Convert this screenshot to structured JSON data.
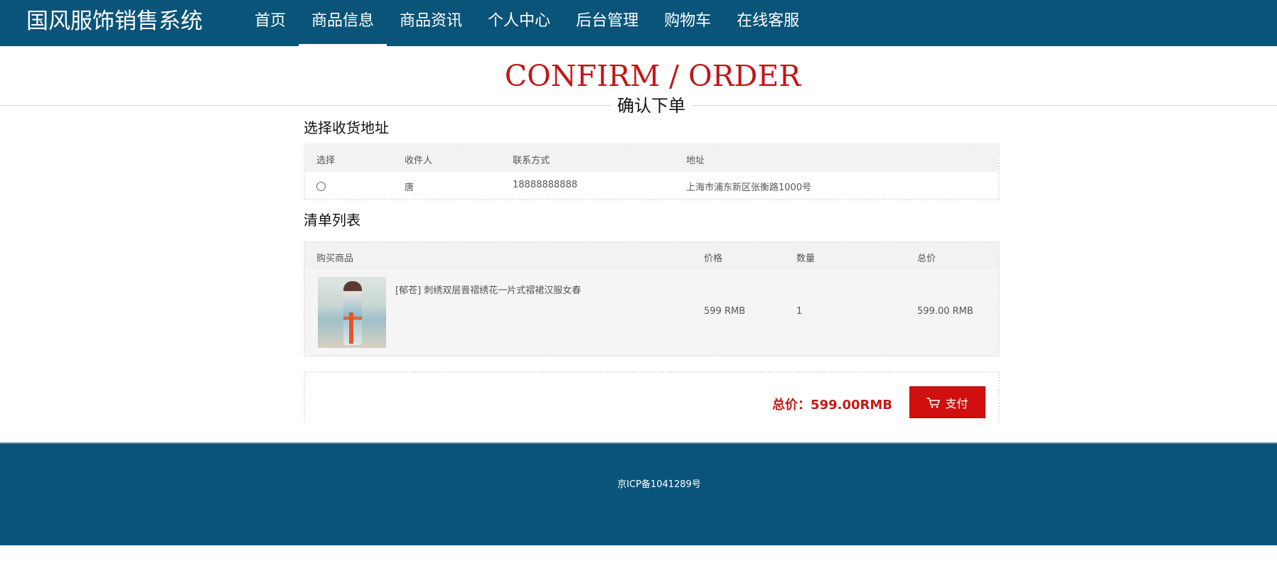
{
  "header": {
    "brand": "国风服饰销售系统",
    "nav": [
      {
        "label": "首页",
        "active": false
      },
      {
        "label": "商品信息",
        "active": true
      },
      {
        "label": "商品资讯",
        "active": false
      },
      {
        "label": "个人中心",
        "active": false
      },
      {
        "label": "后台管理",
        "active": false
      },
      {
        "label": "购物车",
        "active": false
      },
      {
        "label": "在线客服",
        "active": false
      }
    ]
  },
  "page": {
    "title": "CONFIRM / ORDER",
    "subtitle": "确认下单"
  },
  "address_section": {
    "heading": "选择收货地址",
    "columns": [
      "选择",
      "收件人",
      "联系方式",
      "地址"
    ],
    "rows": [
      {
        "selected": false,
        "recipient": "唐",
        "phone": "18888888888",
        "address": "上海市浦东新区张衡路1000号"
      }
    ]
  },
  "list_section": {
    "heading": "清单列表",
    "columns": [
      "购买商品",
      "价格",
      "数量",
      "总价"
    ],
    "items": [
      {
        "name": "[郁苍] 刺绣双层晋褶绣花一片式褶裙汉服女春",
        "price": "599 RMB",
        "quantity": "1",
        "total": "599.00 RMB",
        "image": "hanfu-product-photo"
      }
    ]
  },
  "summary": {
    "total_label": "总价：599.00RMB",
    "pay_label": "支付",
    "pay_icon": "cart-icon"
  },
  "footer": {
    "icp": "京ICP备1041289号"
  },
  "colors": {
    "header_bg": "#0b5479",
    "accent_red": "#c21616",
    "button_red": "#d00f0f"
  }
}
